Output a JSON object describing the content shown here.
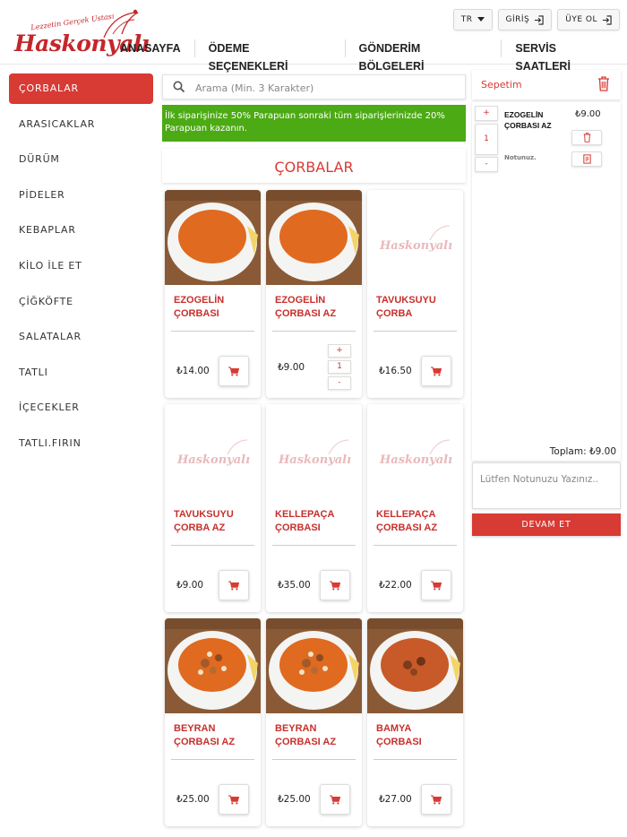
{
  "brand": {
    "name": "Haskonyalı",
    "tagline": "Lezzetin Gerçek Ustası",
    "color": "#c3272b"
  },
  "nav": [
    "ANASAYFA",
    "ÖDEME SEÇENEKLERİ",
    "GÖNDERİM BÖLGELERİ",
    "SERVİS SAATLERİ"
  ],
  "top": {
    "lang": "TR",
    "login": "GİRİŞ",
    "signup": "ÜYE OL"
  },
  "categories": [
    "ÇORBALAR",
    "ARASICAKLAR",
    "DÜRÜM",
    "PİDELER",
    "KEBAPLAR",
    "KİLO İLE ET",
    "ÇİĞKÖFTE",
    "SALATALAR",
    "TATLI",
    "İÇECEKLER",
    "TATLI.FIRIN"
  ],
  "search": {
    "placeholder": "Arama (Min. 3 Karakter)"
  },
  "promo": "İlk siparişinize 50% Parapuan sonraki tüm siparişlerinizde 20% Parapuan kazanın.",
  "section_title": "ÇORBALAR",
  "products": [
    {
      "name": "EZOGELİN ÇORBASI",
      "price": "₺14.00",
      "image": "orange-soup"
    },
    {
      "name": "EZOGELİN ÇORBASI AZ",
      "price": "₺9.00",
      "image": "orange-soup",
      "in_cart_qty": "1"
    },
    {
      "name": "TAVUKSUYU ÇORBA",
      "price": "₺16.50",
      "image": "logo-placeholder"
    },
    {
      "name": "TAVUKSUYU ÇORBA AZ",
      "price": "₺9.00",
      "image": "logo-placeholder"
    },
    {
      "name": "KELLEPAÇA ÇORBASI",
      "price": "₺35.00",
      "image": "logo-placeholder"
    },
    {
      "name": "KELLEPAÇA ÇORBASI AZ",
      "price": "₺22.00",
      "image": "logo-placeholder"
    },
    {
      "name": "BEYRAN ÇORBASI AZ",
      "price": "₺25.00",
      "image": "beyran-soup"
    },
    {
      "name": "BEYRAN ÇORBASI AZ",
      "price": "₺25.00",
      "image": "beyran-soup"
    },
    {
      "name": "BAMYA ÇORBASI",
      "price": "₺27.00",
      "image": "bamya-soup"
    }
  ],
  "stepper": {
    "plus": "+",
    "minus": "-"
  },
  "cart": {
    "title": "Sepetim",
    "items": [
      {
        "name": "EZOGELİN ÇORBASI AZ",
        "price": "₺9.00",
        "qty": "1",
        "note_label": "Notunuz."
      }
    ],
    "total": "Toplam: ₺9.00",
    "note_placeholder": "Lütfen Notunuzu Yazınız..",
    "continue_label": "DEVAM ET"
  },
  "colors": {
    "accent": "#d83a34",
    "promo": "#4caa14"
  }
}
